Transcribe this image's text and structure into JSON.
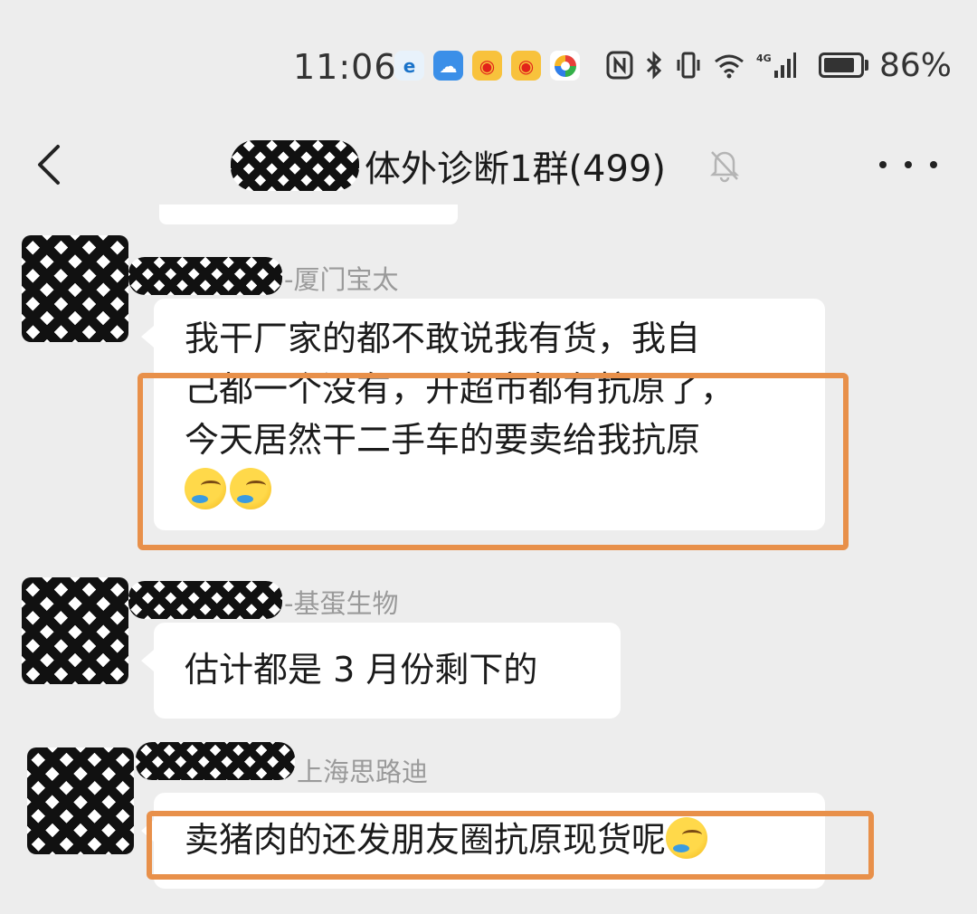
{
  "status_bar": {
    "time": "11:06",
    "battery_percent": "86%",
    "battery_level": 0.86,
    "network": "4G",
    "app_icons": [
      "edge-browser-icon",
      "cloud-icon",
      "weibo-icon",
      "weibo-icon",
      "multicolor-app-icon"
    ],
    "system_icons": [
      "nfc-icon",
      "bluetooth-icon",
      "vibrate-icon",
      "wifi-icon",
      "signal-4g-icon",
      "battery-icon"
    ]
  },
  "header": {
    "back_glyph": "<",
    "title": "体外诊断1群(499)",
    "muted": true,
    "more_glyph": "•••"
  },
  "messages": [
    {
      "sender_suffix": "-厦门宝太",
      "lines": [
        "我干厂家的都不敢说我有货，我自",
        "己都一个没有，开超市都有抗原了，",
        "今天居然干二手车的要卖给我抗原"
      ],
      "trailing_emoji": [
        "face-with-tears-icon",
        "face-with-tears-icon"
      ],
      "highlighted": true
    },
    {
      "sender_suffix": "-基蛋生物",
      "lines": [
        "估计都是 3 月份剩下的"
      ],
      "highlighted": false
    },
    {
      "sender_suffix": "上海思路迪",
      "lines": [
        "卖猪肉的还发朋友圈抗原现货呢"
      ],
      "trailing_emoji": [
        "face-with-tears-icon"
      ],
      "highlighted": true
    }
  ],
  "colors": {
    "background": "#ededed",
    "bubble": "#ffffff",
    "highlight_border": "#e8904a",
    "text": "#1b1b1b",
    "sender_name": "#9a9a9a"
  }
}
